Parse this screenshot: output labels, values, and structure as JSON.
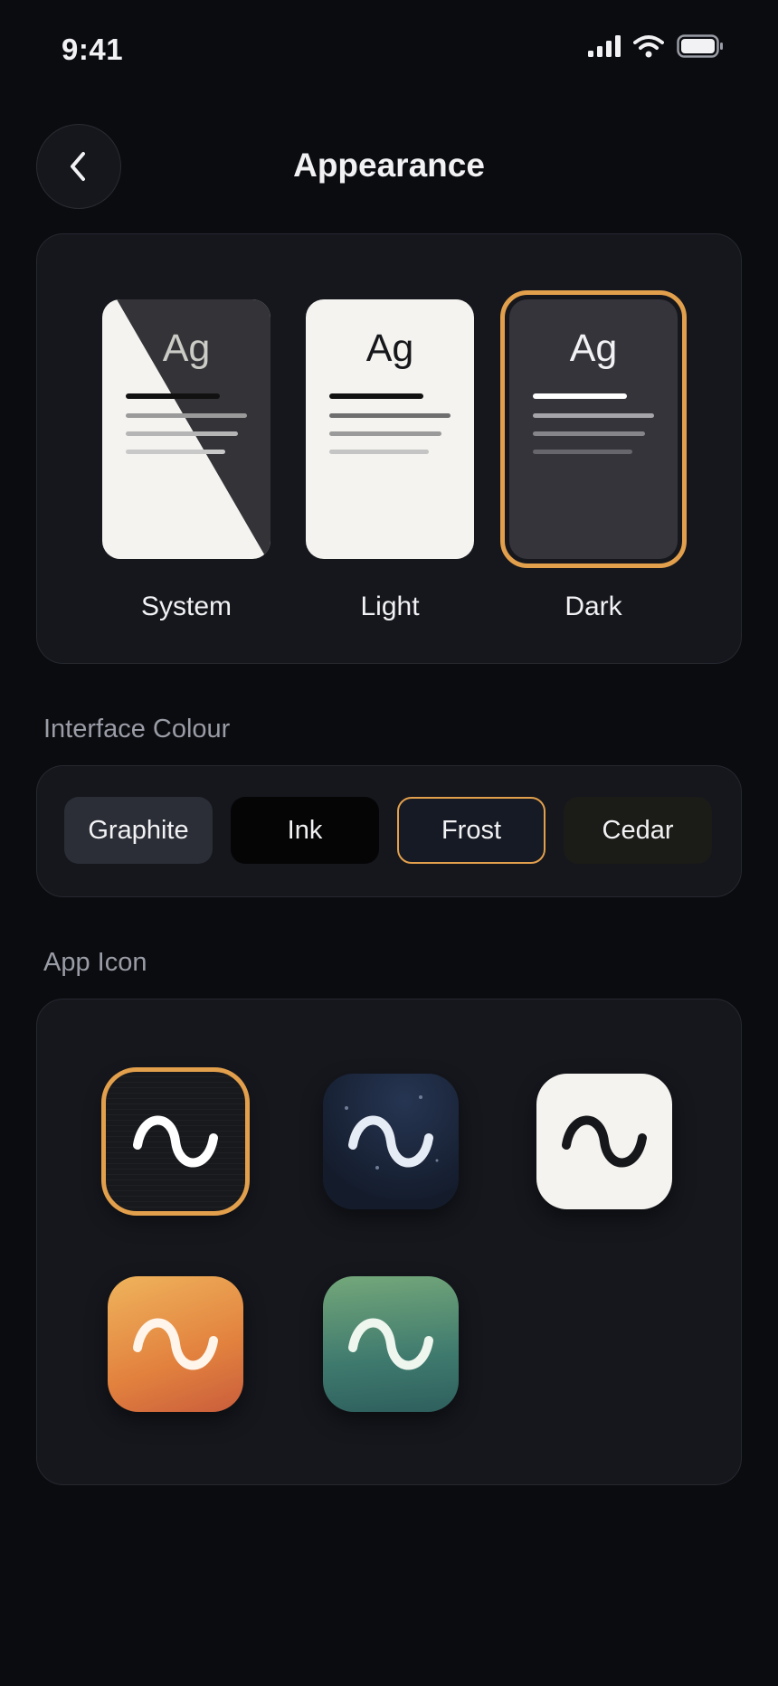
{
  "status_bar": {
    "time": "9:41"
  },
  "nav": {
    "title": "Appearance"
  },
  "theme_modes": [
    {
      "label": "System",
      "preview_text": "Ag",
      "selected": false
    },
    {
      "label": "Light",
      "preview_text": "Ag",
      "selected": false
    },
    {
      "label": "Dark",
      "preview_text": "Ag",
      "selected": true
    }
  ],
  "interface_colour": {
    "label": "Interface Colour",
    "options": [
      {
        "label": "Graphite",
        "selected": false
      },
      {
        "label": "Ink",
        "selected": false
      },
      {
        "label": "Frost",
        "selected": true
      },
      {
        "label": "Cedar",
        "selected": false
      }
    ]
  },
  "app_icon": {
    "label": "App Icon",
    "icons": [
      {
        "name": "dark",
        "selected": true
      },
      {
        "name": "night",
        "selected": false
      },
      {
        "name": "light",
        "selected": false
      },
      {
        "name": "sunset",
        "selected": false
      },
      {
        "name": "forest",
        "selected": false
      }
    ]
  },
  "colors": {
    "accent": "#e3a04c",
    "background": "#0b0c10",
    "card": "#15171d"
  }
}
